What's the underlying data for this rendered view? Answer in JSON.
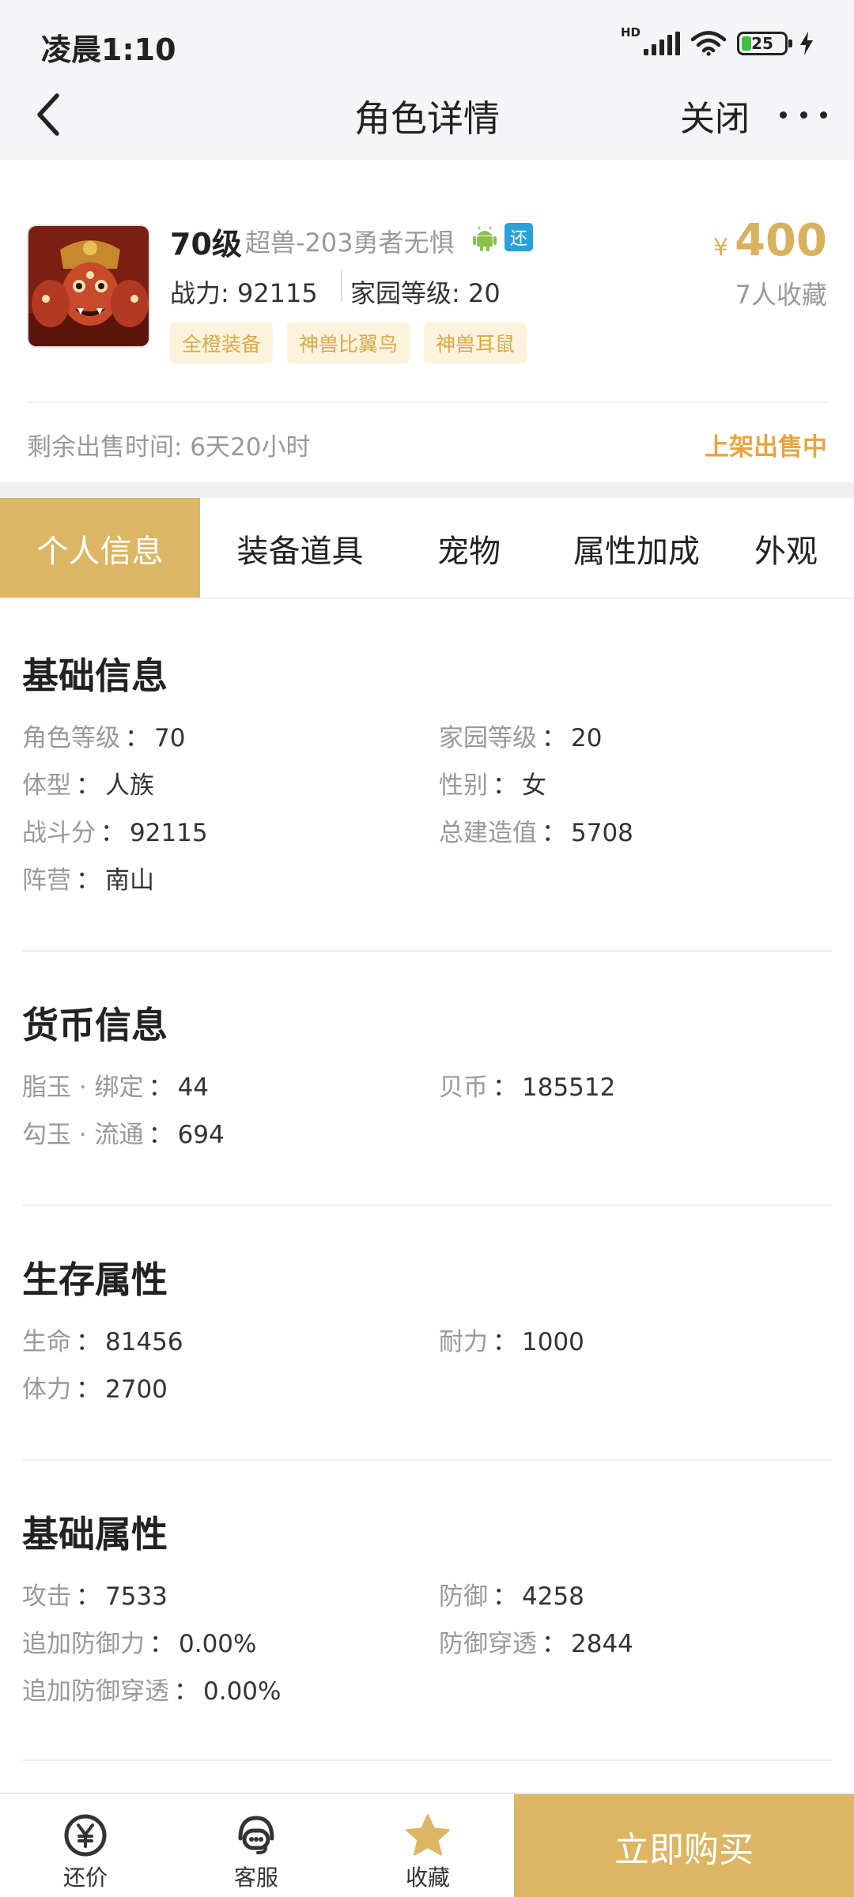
{
  "status": {
    "time": "凌晨1:10",
    "network": "HD",
    "battery": "25"
  },
  "nav": {
    "title": "角色详情",
    "close": "关闭"
  },
  "role": {
    "level": "70级",
    "server": "超兽-203勇者无惧",
    "return_badge": "还",
    "power": "战力: 92115",
    "home_level": "家园等级: 20",
    "tags": [
      "全橙装备",
      "神兽比翼鸟",
      "神兽耳鼠"
    ],
    "currency_symbol": "¥",
    "price": "400",
    "favorites": "7人收藏",
    "remaining": "剩余出售时间: 6天20小时",
    "sale_status": "上架出售中"
  },
  "tabs": [
    "个人信息",
    "装备道具",
    "宠物",
    "属性加成",
    "外观"
  ],
  "sections": [
    {
      "title": "基础信息",
      "items": [
        {
          "k": "角色等级",
          "v": "70"
        },
        {
          "k": "家园等级",
          "v": "20"
        },
        {
          "k": "体型",
          "v": "人族"
        },
        {
          "k": "性别",
          "v": "女"
        },
        {
          "k": "战斗分",
          "v": "92115"
        },
        {
          "k": "总建造值",
          "v": "5708"
        },
        {
          "k": "阵营",
          "v": "南山"
        }
      ]
    },
    {
      "title": "货币信息",
      "items": [
        {
          "k": "脂玉 · 绑定",
          "v": "44"
        },
        {
          "k": "贝币",
          "v": "185512"
        },
        {
          "k": "勾玉 · 流通",
          "v": "694"
        }
      ]
    },
    {
      "title": "生存属性",
      "items": [
        {
          "k": "生命",
          "v": "81456"
        },
        {
          "k": "耐力",
          "v": "1000"
        },
        {
          "k": "体力",
          "v": "2700"
        }
      ]
    },
    {
      "title": "基础属性",
      "items": [
        {
          "k": "攻击",
          "v": "7533"
        },
        {
          "k": "防御",
          "v": "4258"
        },
        {
          "k": "追加防御力",
          "v": "0.00%"
        },
        {
          "k": "防御穿透",
          "v": "2844"
        },
        {
          "k": "追加防御穿透",
          "v": "0.00%"
        }
      ]
    }
  ],
  "kv_separator": "：",
  "bottom": {
    "bargain": "还价",
    "service": "客服",
    "favorite": "收藏",
    "buy": "立即购买"
  },
  "colors": {
    "accent": "#dcb664",
    "tag_bg": "#fcf3dc",
    "sale_status": "#e8a53d",
    "return_badge": "#26a3d8"
  },
  "icons": [
    "back-icon",
    "more-icon",
    "android-icon",
    "yen-coin-icon",
    "service-headset-icon",
    "star-icon"
  ]
}
